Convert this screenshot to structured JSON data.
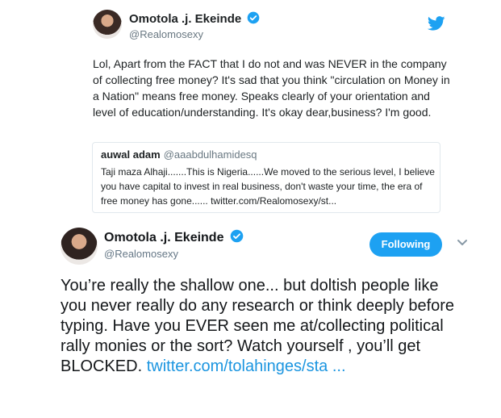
{
  "embedded_tweet": {
    "author_name": "Omotola .j. Ekeinde",
    "author_handle": "@Realomosexy",
    "text": "Lol, Apart from the FACT that I do not and was NEVER in the company of collecting free money? It's sad that you think \"circulation on Money in a Nation\" means free money. Speaks clearly of your orientation and level of education/understanding. It's okay dear,business? I'm good.",
    "quoted": {
      "author_name": "auwal adam",
      "author_handle": "@aaabdulhamidesq",
      "text": "Taji maza Alhaji.......This is Nigeria......We moved to the serious level, I believe you have capital to invest in real  business, don't waste your time, the era of free money has gone...... twitter.com/Realomosexy/st..."
    }
  },
  "main_tweet": {
    "author_name": "Omotola .j. Ekeinde",
    "author_handle": "@Realomosexy",
    "follow_label": "Following",
    "text": "You’re really the shallow one... but doltish people like you never really do any research or think deeply before typing. Have you EVER seen me at/collecting political rally monies or the sort? Watch yourself , you’ll get BLOCKED.",
    "link": "twitter.com/tolahinges/sta ..."
  },
  "icons": [
    "verified-badge-icon",
    "twitter-bird-icon",
    "chevron-down-icon"
  ],
  "colors": {
    "accent": "#1da1f2",
    "link": "#1b95e0",
    "verified": "#1da1f2"
  }
}
